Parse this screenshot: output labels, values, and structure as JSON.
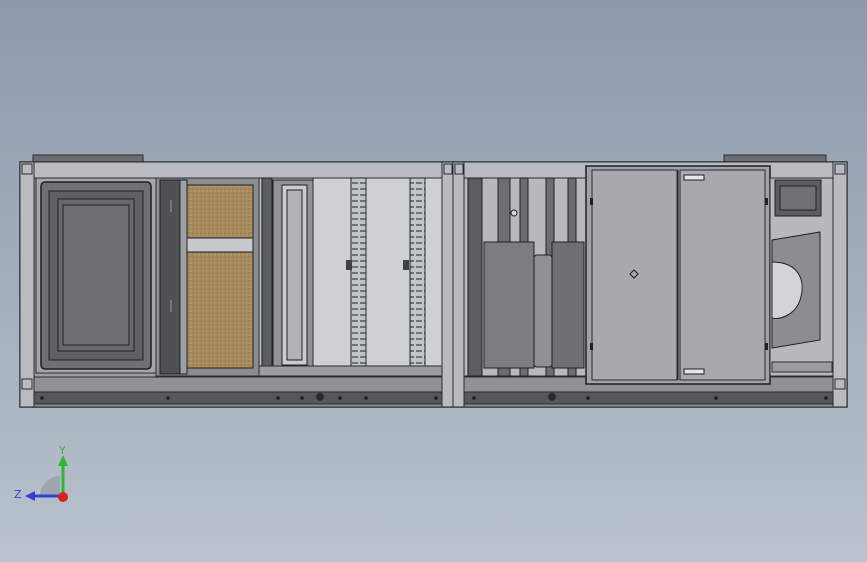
{
  "viewport": {
    "background_top": "#8e9aab",
    "background_bottom": "#b9c2cd",
    "model": "air-handling-unit-side-view"
  },
  "triad": {
    "y_label": "Y",
    "z_label": "Z",
    "y_color": "#2fb52f",
    "z_color": "#2f3fd8",
    "x_color": "#d82020"
  }
}
